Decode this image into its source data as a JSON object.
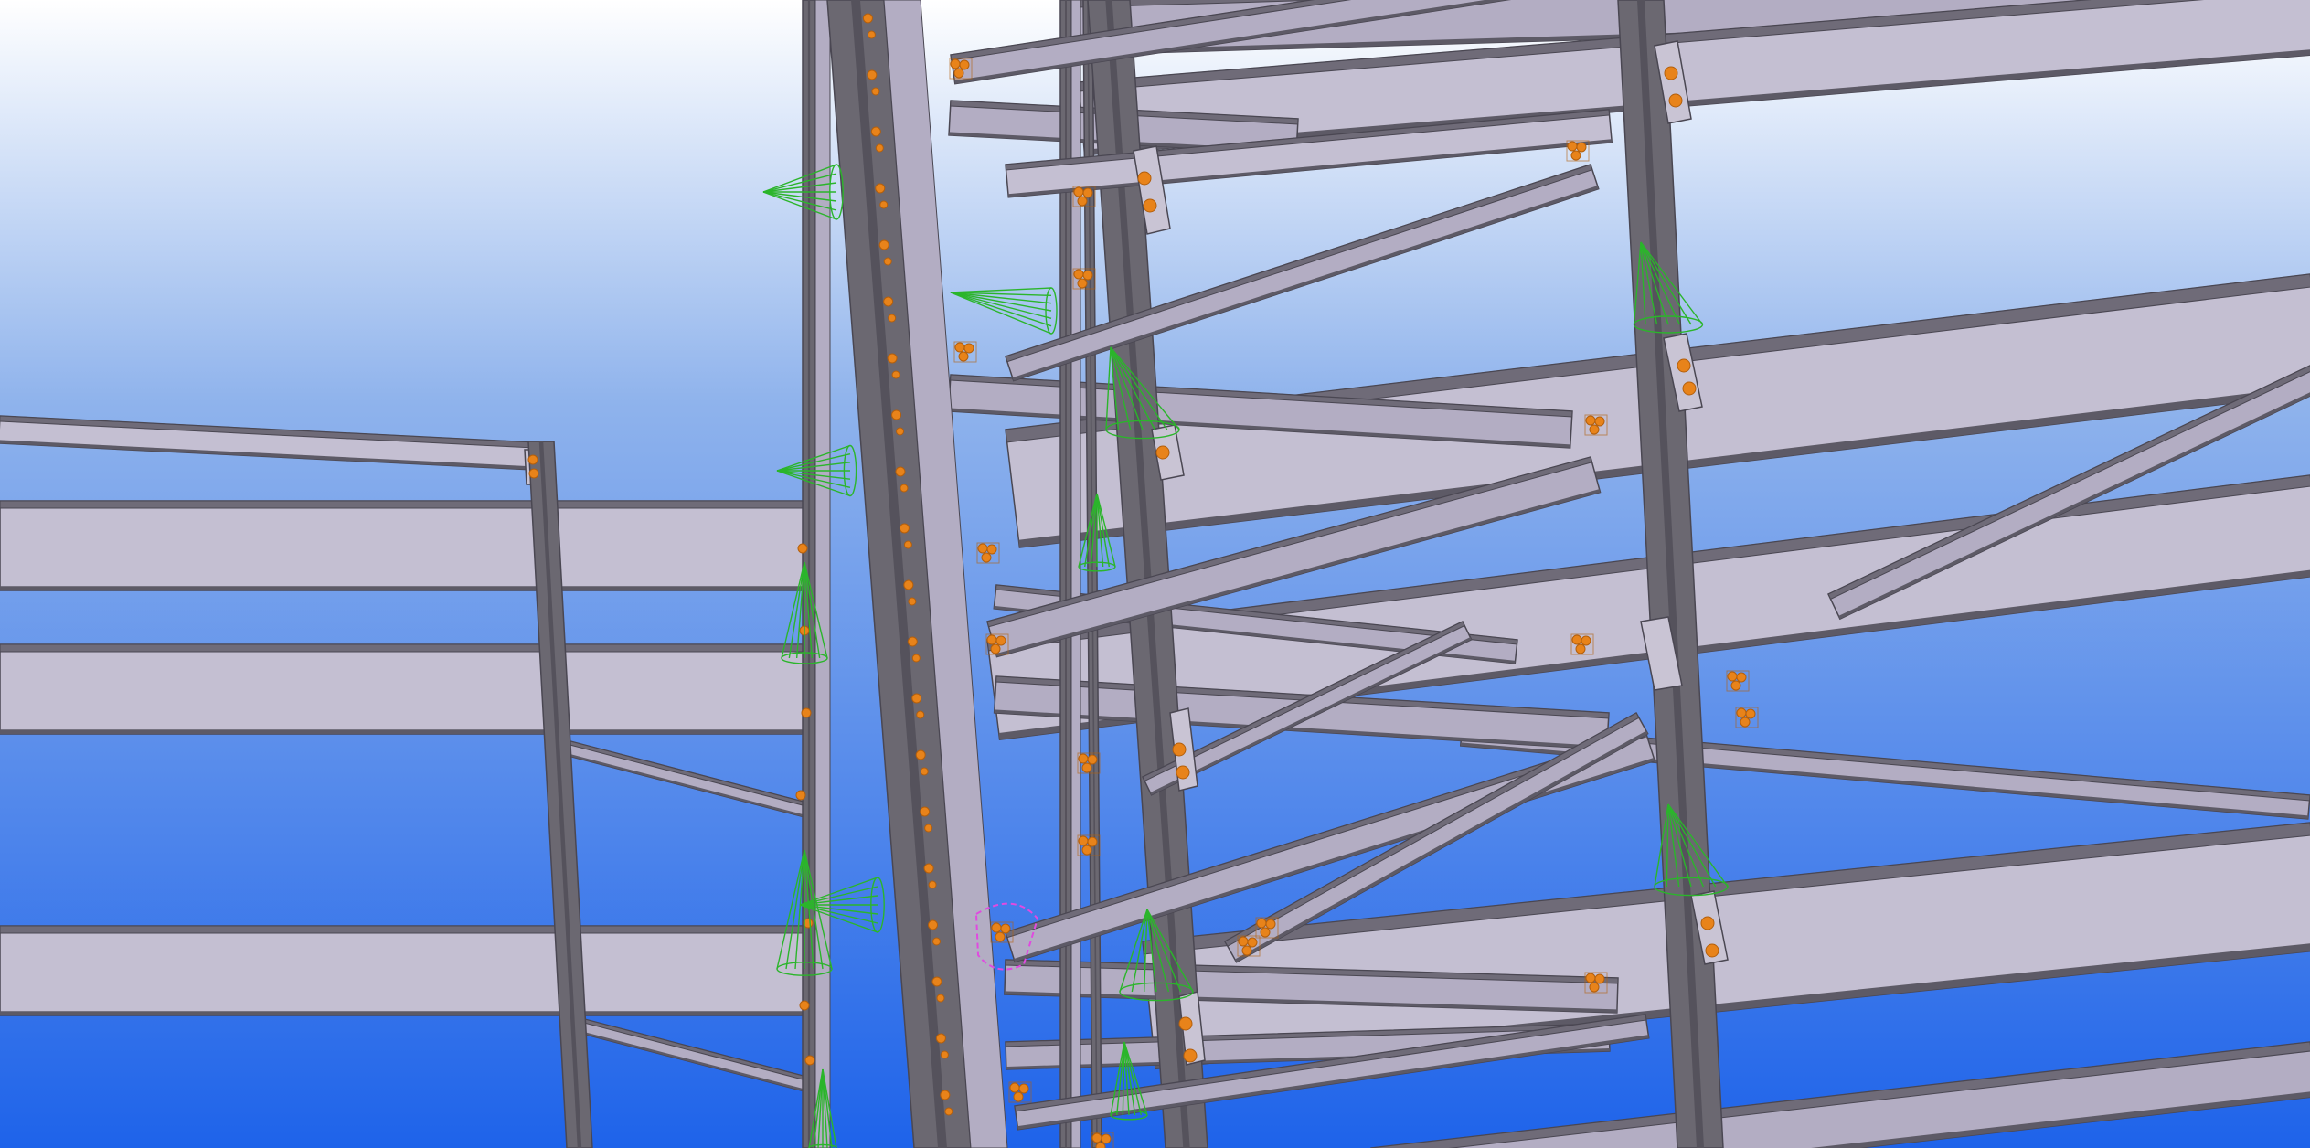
{
  "viewport": {
    "background": {
      "top": "#ffffff",
      "middle": "#8fb3ec",
      "bottom": "#1e63ea"
    }
  },
  "materials": {
    "beam_face": "#b3adc3",
    "beam_face_light": "#c4bfd2",
    "beam_flange": "#6f6b78",
    "beam_shadow": "#5d5a66",
    "beam_edge": "#4a4752",
    "column_dark": "#6b6871",
    "column_darker": "#55525c",
    "bolt": "#e8831a",
    "bolt_dark": "#b35f0c",
    "plate": "#c9c4d4",
    "load_symbol": "#2bb52b",
    "selection": "#e04ae0"
  }
}
